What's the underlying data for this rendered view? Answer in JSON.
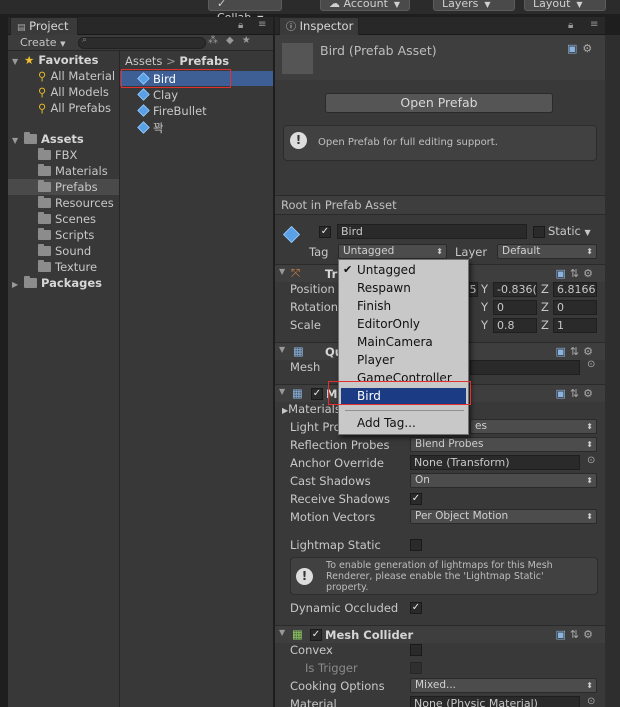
{
  "toolbar": {
    "collab": "Collab",
    "account": "Account",
    "layers": "Layers",
    "layout": "Layout"
  },
  "project": {
    "tab_title": "Project",
    "create_label": "Create",
    "breadcrumb": [
      "Assets",
      "Prefabs"
    ],
    "favorites_label": "Favorites",
    "favorites": [
      "All Material",
      "All Models",
      "All Prefabs"
    ],
    "assets_label": "Assets",
    "folders": [
      "FBX",
      "Materials",
      "Prefabs",
      "Resources",
      "Scenes",
      "Scripts",
      "Sound",
      "Texture"
    ],
    "packages_label": "Packages",
    "files": [
      "Bird",
      "Clay",
      "FireBullet",
      "꽉"
    ]
  },
  "inspector": {
    "tab_title": "Inspector",
    "asset_title": "Bird (Prefab Asset)",
    "open_prefab": "Open Prefab",
    "info_text": "Open Prefab for full editing support.",
    "root_label": "Root in Prefab Asset",
    "object_name": "Bird",
    "static_label": "Static",
    "tag_label": "Tag",
    "tag_value": "Untagged",
    "layer_label": "Layer",
    "layer_value": "Default",
    "transform": {
      "title": "Tr",
      "position_label": "Position",
      "position": {
        "x": ".5",
        "y": "-0.836(",
        "z": "6.8166"
      },
      "rotation_label": "Rotation",
      "rotation": {
        "y": "0",
        "z": "0"
      },
      "scale_label": "Scale",
      "scale": {
        "y": "0.8",
        "z": "1"
      },
      "axis": {
        "y": "Y",
        "z": "Z"
      }
    },
    "mesh_filter": {
      "title": "Qu",
      "mesh_label": "Mesh"
    },
    "renderer": {
      "title": "M",
      "materials_label": "Materials",
      "light_probes_label": "Light Pro",
      "light_probes_value": "es",
      "reflection_label": "Reflection Probes",
      "reflection_value": "Blend Probes",
      "anchor_label": "Anchor Override",
      "anchor_value": "None (Transform)",
      "cast_label": "Cast Shadows",
      "cast_value": "On",
      "receive_label": "Receive Shadows",
      "motion_label": "Motion Vectors",
      "motion_value": "Per Object Motion",
      "lightmap_label": "Lightmap Static",
      "lightmap_info": [
        "To enable generation of lightmaps for this Mesh",
        "Renderer, please enable the 'Lightmap Static'",
        "property."
      ],
      "occluded_label": "Dynamic Occluded"
    },
    "mesh_collider": {
      "title": "Mesh Collider",
      "convex_label": "Convex",
      "trigger_label": "Is Trigger",
      "cooking_label": "Cooking Options",
      "cooking_value": "Mixed...",
      "material_label": "Material",
      "material_value": "None (Physic Material)"
    }
  },
  "tag_menu": {
    "items": [
      "Untagged",
      "Respawn",
      "Finish",
      "EditorOnly",
      "MainCamera",
      "Player",
      "GameController",
      "Bird"
    ],
    "checked": "Untagged",
    "selected": "Bird",
    "add_tag": "Add Tag..."
  },
  "colors": {
    "selection": "#1b3b84",
    "highlight_box": "#e03030",
    "file_selected": "#3e5f96"
  }
}
